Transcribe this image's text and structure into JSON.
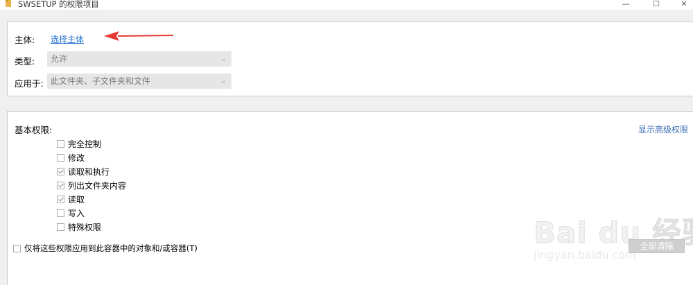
{
  "window": {
    "title": "SWSETUP 的权限项目",
    "minimize_glyph": "—",
    "maximize_glyph": "☐",
    "close_glyph": "✕"
  },
  "principal": {
    "label": "主体:",
    "link": "选择主体"
  },
  "type": {
    "label": "类型:",
    "value": "允许"
  },
  "applies_to": {
    "label": "应用于:",
    "value": "此文件夹、子文件夹和文件"
  },
  "basic_permissions": {
    "label": "基本权限:",
    "advanced_link": "显示高级权限",
    "items": [
      {
        "label": "完全控制",
        "checked": false
      },
      {
        "label": "修改",
        "checked": false
      },
      {
        "label": "读取和执行",
        "checked": true
      },
      {
        "label": "列出文件夹内容",
        "checked": true
      },
      {
        "label": "读取",
        "checked": true
      },
      {
        "label": "写入",
        "checked": false
      },
      {
        "label": "特殊权限",
        "checked": false
      }
    ]
  },
  "apply_only": {
    "label": "仅将这些权限应用到此容器中的对象和/或容器(T)",
    "checked": false
  },
  "clear_all_button": "全部清除",
  "watermark": {
    "main": "Bai du 经验",
    "sub": "jingyan.baidu.com"
  },
  "colors": {
    "link": "#1f6fd0",
    "annotation_arrow": "#e53935"
  }
}
